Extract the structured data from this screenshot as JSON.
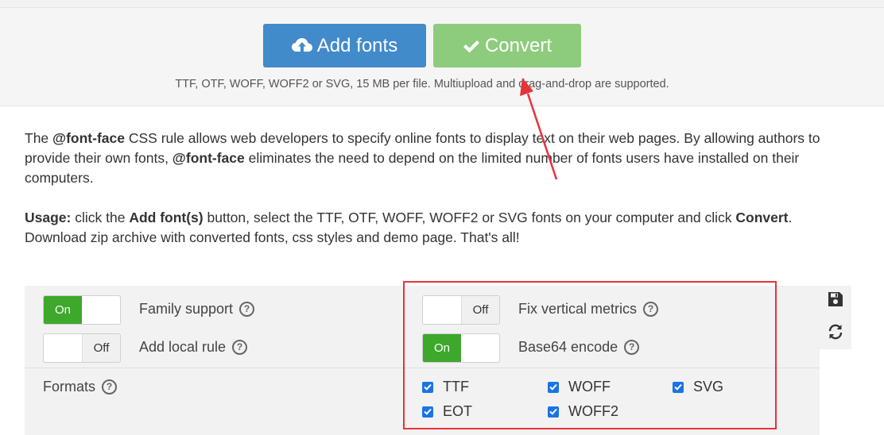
{
  "upload": {
    "add_fonts_label": "Add fonts",
    "convert_label": "Convert",
    "hint": "TTF, OTF, WOFF, WOFF2 or SVG, 15 MB per file. Multiupload and drag-and-drop are supported."
  },
  "description": {
    "p1_a": "The ",
    "p1_b": "@font-face",
    "p1_c": " CSS rule allows web developers to specify online fonts to display text on their web pages. By allowing authors to provide their own fonts, ",
    "p1_d": "@font-face",
    "p1_e": " eliminates the need to depend on the limited number of fonts users have installed on their computers.",
    "p2_a": "Usage:",
    "p2_b": " click the ",
    "p2_c": "Add font(s)",
    "p2_d": " button, select the TTF, OTF, WOFF, WOFF2 or SVG fonts on your computer and click ",
    "p2_e": "Convert",
    "p2_f": ". Download zip archive with converted fonts, css styles and demo page. That's all!"
  },
  "options": {
    "family_support": {
      "label": "Family support",
      "state": "On",
      "on_text": "On"
    },
    "add_local_rule": {
      "label": "Add local rule",
      "state": "Off",
      "off_text": "Off"
    },
    "fix_vertical_metrics": {
      "label": "Fix vertical metrics",
      "state": "Off",
      "off_text": "Off"
    },
    "base64_encode": {
      "label": "Base64 encode",
      "state": "On",
      "on_text": "On"
    },
    "help_glyph": "?"
  },
  "formats": {
    "label": "Formats",
    "items": [
      {
        "name": "TTF",
        "checked": true
      },
      {
        "name": "WOFF",
        "checked": true
      },
      {
        "name": "SVG",
        "checked": true
      },
      {
        "name": "EOT",
        "checked": true
      },
      {
        "name": "WOFF2",
        "checked": true
      }
    ]
  },
  "icons": {
    "save": "save-icon",
    "reset": "refresh-icon",
    "upload": "cloud-upload-icon",
    "check": "checkmark-icon"
  },
  "colors": {
    "add_button": "#428bca",
    "convert_button": "#8dcc7c",
    "toggle_on": "#3ea82d",
    "checkbox": "#1a73e8",
    "annotation_red": "#e8333a"
  }
}
